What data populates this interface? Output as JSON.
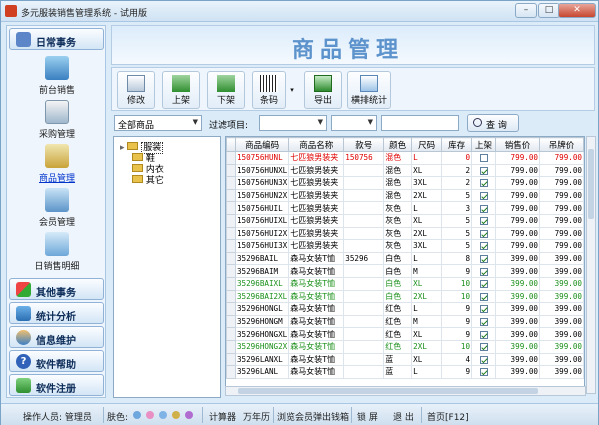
{
  "window": {
    "title": "多元服装销售管理系统 - 试用版",
    "min_label": "–",
    "max_label": "□",
    "close_label": "✕"
  },
  "nav": {
    "daily_header": "日常事务",
    "items": [
      {
        "label": "前台销售",
        "icon": "pos-icon"
      },
      {
        "label": "采购管理",
        "icon": "purchase-icon"
      },
      {
        "label": "商品管理",
        "icon": "goods-icon",
        "active": true
      },
      {
        "label": "会员管理",
        "icon": "member-icon"
      },
      {
        "label": "日销售明细",
        "icon": "daily-detail-icon"
      }
    ],
    "sections": [
      {
        "label": "其他事务",
        "icon": "grid-icon"
      },
      {
        "label": "统计分析",
        "icon": "chart-icon"
      },
      {
        "label": "信息维护",
        "icon": "people-icon"
      },
      {
        "label": "软件帮助",
        "icon": "help-icon"
      },
      {
        "label": "软件注册",
        "icon": "register-icon"
      }
    ]
  },
  "banner": {
    "title": "商品管理"
  },
  "toolbar": {
    "edit": "修改",
    "list_on": "上架",
    "list_off": "下架",
    "barcode": "条码",
    "export": "导出",
    "cross_stats": "横排统计"
  },
  "filter": {
    "category": "全部商品",
    "filter_label": "过滤项目:",
    "search": "查 询"
  },
  "tree": {
    "root": "服装",
    "children": [
      "鞋",
      "内衣",
      "其它"
    ]
  },
  "grid": {
    "columns": [
      "商品编码",
      "商品名称",
      "款号",
      "颜色",
      "尺码",
      "库存",
      "上架",
      "销售价",
      "吊牌价"
    ],
    "rows": [
      {
        "code": "150756HUNL",
        "name": "七匹狼男装夹",
        "style": "150756",
        "color": "混色",
        "size": "L",
        "stock": "0",
        "on": false,
        "sale": "799.00",
        "tag": "799.00",
        "kind": "sel"
      },
      {
        "code": "150756HUNXL",
        "name": "七匹狼男装夹",
        "style": "",
        "color": "混色",
        "size": "XL",
        "stock": "2",
        "on": true,
        "sale": "799.00",
        "tag": "799.00",
        "kind": ""
      },
      {
        "code": "150756HUN3X",
        "name": "七匹狼男装夹",
        "style": "",
        "color": "混色",
        "size": "3XL",
        "stock": "2",
        "on": true,
        "sale": "799.00",
        "tag": "799.00",
        "kind": ""
      },
      {
        "code": "150756HUN2X",
        "name": "七匹狼男装夹",
        "style": "",
        "color": "混色",
        "size": "2XL",
        "stock": "5",
        "on": true,
        "sale": "799.00",
        "tag": "799.00",
        "kind": ""
      },
      {
        "code": "150756HUIL",
        "name": "七匹狼男装夹",
        "style": "",
        "color": "灰色",
        "size": "L",
        "stock": "3",
        "on": true,
        "sale": "799.00",
        "tag": "799.00",
        "kind": ""
      },
      {
        "code": "150756HUIXL",
        "name": "七匹狼男装夹",
        "style": "",
        "color": "灰色",
        "size": "XL",
        "stock": "5",
        "on": true,
        "sale": "799.00",
        "tag": "799.00",
        "kind": ""
      },
      {
        "code": "150756HUI2X",
        "name": "七匹狼男装夹",
        "style": "",
        "color": "灰色",
        "size": "2XL",
        "stock": "5",
        "on": true,
        "sale": "799.00",
        "tag": "799.00",
        "kind": ""
      },
      {
        "code": "150756HUI3X",
        "name": "七匹狼男装夹",
        "style": "",
        "color": "灰色",
        "size": "3XL",
        "stock": "5",
        "on": true,
        "sale": "799.00",
        "tag": "799.00",
        "kind": ""
      },
      {
        "code": "35296BAIL",
        "name": "森马女装T恤",
        "style": "35296",
        "color": "白色",
        "size": "L",
        "stock": "8",
        "on": true,
        "sale": "399.00",
        "tag": "399.00",
        "kind": ""
      },
      {
        "code": "35296BAIM",
        "name": "森马女装T恤",
        "style": "",
        "color": "白色",
        "size": "M",
        "stock": "9",
        "on": true,
        "sale": "399.00",
        "tag": "399.00",
        "kind": ""
      },
      {
        "code": "35296BAIXL",
        "name": "森马女装T恤",
        "style": "",
        "color": "白色",
        "size": "XL",
        "stock": "10",
        "on": true,
        "sale": "399.00",
        "tag": "399.00",
        "kind": "green"
      },
      {
        "code": "35296BAI2XL",
        "name": "森马女装T恤",
        "style": "",
        "color": "白色",
        "size": "2XL",
        "stock": "10",
        "on": true,
        "sale": "399.00",
        "tag": "399.00",
        "kind": "green"
      },
      {
        "code": "35296HONGL",
        "name": "森马女装T恤",
        "style": "",
        "color": "红色",
        "size": "L",
        "stock": "9",
        "on": true,
        "sale": "399.00",
        "tag": "399.00",
        "kind": ""
      },
      {
        "code": "35296HONGM",
        "name": "森马女装T恤",
        "style": "",
        "color": "红色",
        "size": "M",
        "stock": "9",
        "on": true,
        "sale": "399.00",
        "tag": "399.00",
        "kind": ""
      },
      {
        "code": "35296HONGXL",
        "name": "森马女装T恤",
        "style": "",
        "color": "红色",
        "size": "XL",
        "stock": "9",
        "on": true,
        "sale": "399.00",
        "tag": "399.00",
        "kind": ""
      },
      {
        "code": "35296HONG2X",
        "name": "森马女装T恤",
        "style": "",
        "color": "红色",
        "size": "2XL",
        "stock": "10",
        "on": true,
        "sale": "399.00",
        "tag": "399.00",
        "kind": "green"
      },
      {
        "code": "35296LANXL",
        "name": "森马女装T恤",
        "style": "",
        "color": "蓝",
        "size": "XL",
        "stock": "4",
        "on": true,
        "sale": "399.00",
        "tag": "399.00",
        "kind": ""
      },
      {
        "code": "35296LANL",
        "name": "森马女装T恤",
        "style": "",
        "color": "蓝",
        "size": "L",
        "stock": "9",
        "on": true,
        "sale": "399.00",
        "tag": "399.00",
        "kind": ""
      }
    ]
  },
  "status": {
    "operator": "操作人员: 管理员",
    "skin": "肤色:",
    "calc": "计算器",
    "calendar": "万年历",
    "browse_member": "浏览会员",
    "popup_drawer": "弹出钱箱",
    "lock": "锁 屏",
    "exit": "退 出",
    "home": "首页[F12]"
  },
  "colors": {
    "accent": "#5d93cc",
    "selected_row": "#e00000",
    "highlight_row": "#1a8f1a"
  }
}
